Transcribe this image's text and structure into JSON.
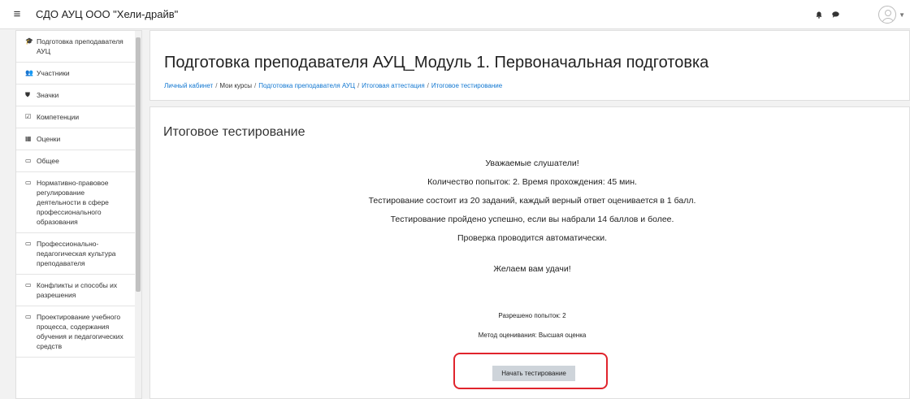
{
  "navbar": {
    "menu_icon": "hamburger-icon",
    "site_name": "СДО АУЦ ООО \"Хели-драйв\"",
    "notification_icon": "bell-icon",
    "messages_icon": "chat-icon",
    "avatar_icon": "user-avatar-icon"
  },
  "sidebar": {
    "items": [
      {
        "icon": "graduation-cap-icon",
        "glyph": "🎓",
        "label": "Подготовка преподавателя АУЦ"
      },
      {
        "icon": "users-icon",
        "glyph": "👥",
        "label": "Участники"
      },
      {
        "icon": "shield-icon",
        "glyph": "⛊",
        "label": "Значки"
      },
      {
        "icon": "checkbox-icon",
        "glyph": "☑",
        "label": "Компетенции"
      },
      {
        "icon": "table-icon",
        "glyph": "▦",
        "label": "Оценки"
      },
      {
        "icon": "folder-icon",
        "glyph": "▭",
        "label": "Общее"
      },
      {
        "icon": "folder-icon",
        "glyph": "▭",
        "label": "Нормативно-правовое регулирование деятельности в сфере профессионального образования"
      },
      {
        "icon": "folder-icon",
        "glyph": "▭",
        "label": "Профессионально-педагогическая культура преподавателя"
      },
      {
        "icon": "folder-icon",
        "glyph": "▭",
        "label": "Конфликты и способы их разрешения"
      },
      {
        "icon": "folder-icon",
        "glyph": "▭",
        "label": "Проектирование учебного процесса, содержания обучения и педагогических средств"
      }
    ]
  },
  "header": {
    "title": "Подготовка преподавателя АУЦ_Модуль 1. Первоначальная подготовка",
    "breadcrumb": [
      "Личный кабинет",
      "Мои курсы",
      "Подготовка преподавателя АУЦ",
      "Итоговая аттестация",
      "Итоговое тестирование"
    ],
    "separator": "/"
  },
  "main": {
    "section_title": "Итоговое тестирование",
    "intro_lines": [
      "Уважаемые слушатели!",
      "Количество попыток: 2. Время прохождения: 45 мин.",
      "Тестирование состоит из 20 заданий, каждый верный ответ оценивается в 1 балл.",
      "Тестирование пройдено успешно, если вы набрали 14 баллов и более.",
      "Проверка проводится автоматически."
    ],
    "wish": "Желаем вам удачи!",
    "attempts_allowed": "Разрешено попыток: 2",
    "grading_method": "Метод оценивания: Высшая оценка",
    "start_button": "Начать тестирование",
    "highlight_color": "#e0242c"
  }
}
